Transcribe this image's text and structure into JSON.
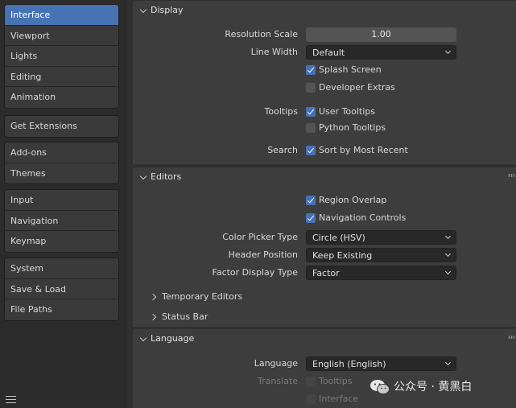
{
  "sidebar": {
    "groups": [
      {
        "items": [
          {
            "label": "Interface",
            "active": true
          },
          {
            "label": "Viewport"
          },
          {
            "label": "Lights"
          },
          {
            "label": "Editing"
          },
          {
            "label": "Animation"
          }
        ]
      },
      {
        "items": [
          {
            "label": "Get Extensions"
          }
        ]
      },
      {
        "items": [
          {
            "label": "Add-ons"
          },
          {
            "label": "Themes"
          }
        ]
      },
      {
        "items": [
          {
            "label": "Input"
          },
          {
            "label": "Navigation"
          },
          {
            "label": "Keymap"
          }
        ]
      },
      {
        "items": [
          {
            "label": "System"
          },
          {
            "label": "Save & Load"
          },
          {
            "label": "File Paths"
          }
        ]
      }
    ],
    "menu_icon": "hamburger-icon"
  },
  "display": {
    "title": "Display",
    "resolution_scale_label": "Resolution Scale",
    "resolution_scale_value": "1.00",
    "line_width_label": "Line Width",
    "line_width_value": "Default",
    "splash_screen": {
      "label": "Splash Screen",
      "checked": true
    },
    "developer_extras": {
      "label": "Developer Extras",
      "checked": false
    },
    "tooltips_label": "Tooltips",
    "user_tooltips": {
      "label": "User Tooltips",
      "checked": true
    },
    "python_tooltips": {
      "label": "Python Tooltips",
      "checked": false
    },
    "search_label": "Search",
    "sort_by_most_recent": {
      "label": "Sort by Most Recent",
      "checked": true
    }
  },
  "editors": {
    "title": "Editors",
    "region_overlap": {
      "label": "Region Overlap",
      "checked": true
    },
    "navigation_controls": {
      "label": "Navigation Controls",
      "checked": true
    },
    "color_picker_type_label": "Color Picker Type",
    "color_picker_type_value": "Circle (HSV)",
    "header_position_label": "Header Position",
    "header_position_value": "Keep Existing",
    "factor_display_type_label": "Factor Display Type",
    "factor_display_type_value": "Factor",
    "temporary_editors": "Temporary Editors",
    "status_bar": "Status Bar"
  },
  "language": {
    "title": "Language",
    "language_label": "Language",
    "language_value": "English (English)",
    "translate_label": "Translate",
    "tooltips": {
      "label": "Tooltips",
      "checked": false
    },
    "interface": {
      "label": "Interface",
      "checked": false
    }
  },
  "watermark": {
    "text": "公众号 · 黄黑白",
    "icon": "wechat-logo-icon"
  },
  "colors": {
    "accent": "#4772b3",
    "panel": "#3d3d3d",
    "background": "#303030",
    "field": "#282828"
  }
}
